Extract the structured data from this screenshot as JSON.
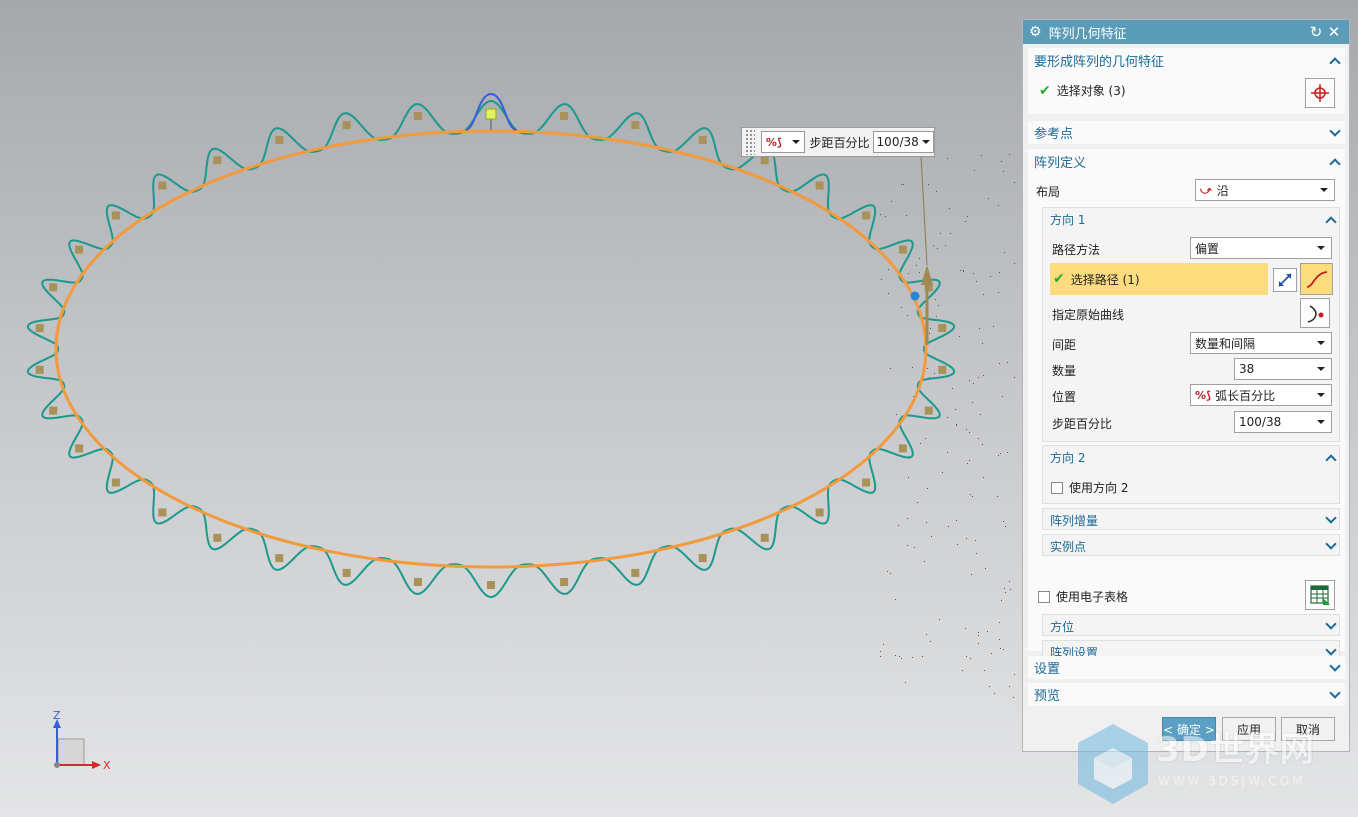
{
  "floating_toolbar": {
    "icon": "arc-percent-icon",
    "label": "步距百分比",
    "value": "100/38"
  },
  "dialog": {
    "title": "阵列几何特征",
    "feature_section": {
      "title": "要形成阵列的几何特征",
      "select_label": "选择对象 (3)"
    },
    "reference_point": {
      "title": "参考点"
    },
    "pattern_definition": {
      "title": "阵列定义",
      "layout_label": "布局",
      "layout_value": "沿",
      "direction1": {
        "title": "方向 1",
        "path_method_label": "路径方法",
        "path_method_value": "偏置",
        "select_path_label": "选择路径 (1)",
        "specify_curve_label": "指定原始曲线",
        "spacing_label": "间距",
        "spacing_value": "数量和间隔",
        "count_label": "数量",
        "count_value": "38",
        "position_label": "位置",
        "position_value": "弧长百分比",
        "step_label": "步距百分比",
        "step_value": "100/38"
      },
      "direction2": {
        "title": "方向 2",
        "use_label": "使用方向 2"
      },
      "increment": {
        "title": "阵列增量"
      },
      "instance_point": {
        "title": "实例点"
      },
      "spreadsheet_label": "使用电子表格",
      "orientation": {
        "title": "方位"
      },
      "pattern_settings": {
        "title": "阵列设置"
      }
    },
    "settings": {
      "title": "设置"
    },
    "preview": {
      "title": "预览"
    },
    "buttons": {
      "ok": "< 确定 >",
      "apply": "应用",
      "cancel": "取消"
    }
  },
  "triad": {
    "z": "Z",
    "x": "X"
  },
  "watermark": {
    "title": "3D世界网",
    "url": "WWW.3DSJW.COM"
  },
  "colors": {
    "title_bar": "#5a9bb8",
    "section_heading": "#1d6a96",
    "highlight": "#fcdc7c",
    "path_curve": "#f39a3c",
    "pattern_curve": "#1a9a8c",
    "selected_curve": "#3a5cd8"
  }
}
